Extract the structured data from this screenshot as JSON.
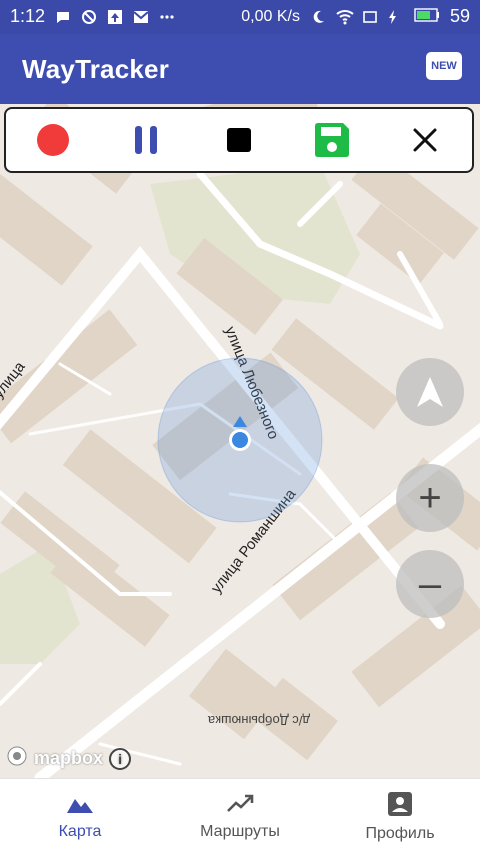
{
  "status_bar": {
    "time": "1:12",
    "network_speed": "0,00 K/s",
    "battery": "59",
    "notification_icons": [
      "chat-bubble-icon",
      "blocked-icon",
      "upload-icon",
      "mail-icon",
      "more-icon"
    ],
    "system_icons": [
      "moon-icon",
      "wifi-icon",
      "rotate-icon",
      "charging-icon",
      "battery-icon"
    ]
  },
  "app_bar": {
    "title": "WayTracker",
    "new_badge": "NEW"
  },
  "controls": {
    "record": "record-icon",
    "pause": "pause-icon",
    "stop": "stop-icon",
    "save": "save-icon",
    "close": "close-icon",
    "colors": {
      "record": "#f13a3a",
      "pause": "#3d4db0",
      "stop": "#000000",
      "save": "#1ebc46",
      "close": "#111111"
    }
  },
  "map": {
    "street_labels": [
      "улица Любезного",
      "улица Романшина",
      "улица",
      "д/с Добрынюшка"
    ],
    "attribution": "mapbox",
    "info": "i",
    "compass": "navigation-icon",
    "zoom_in": "+",
    "zoom_out": "–"
  },
  "bottom_nav": {
    "items": [
      {
        "label": "Карта",
        "icon": "map-icon",
        "active": true
      },
      {
        "label": "Маршруты",
        "icon": "trending-icon",
        "active": false
      },
      {
        "label": "Профиль",
        "icon": "profile-icon",
        "active": false
      }
    ],
    "active_color": "#3d4db0",
    "inactive_color": "#555555"
  }
}
